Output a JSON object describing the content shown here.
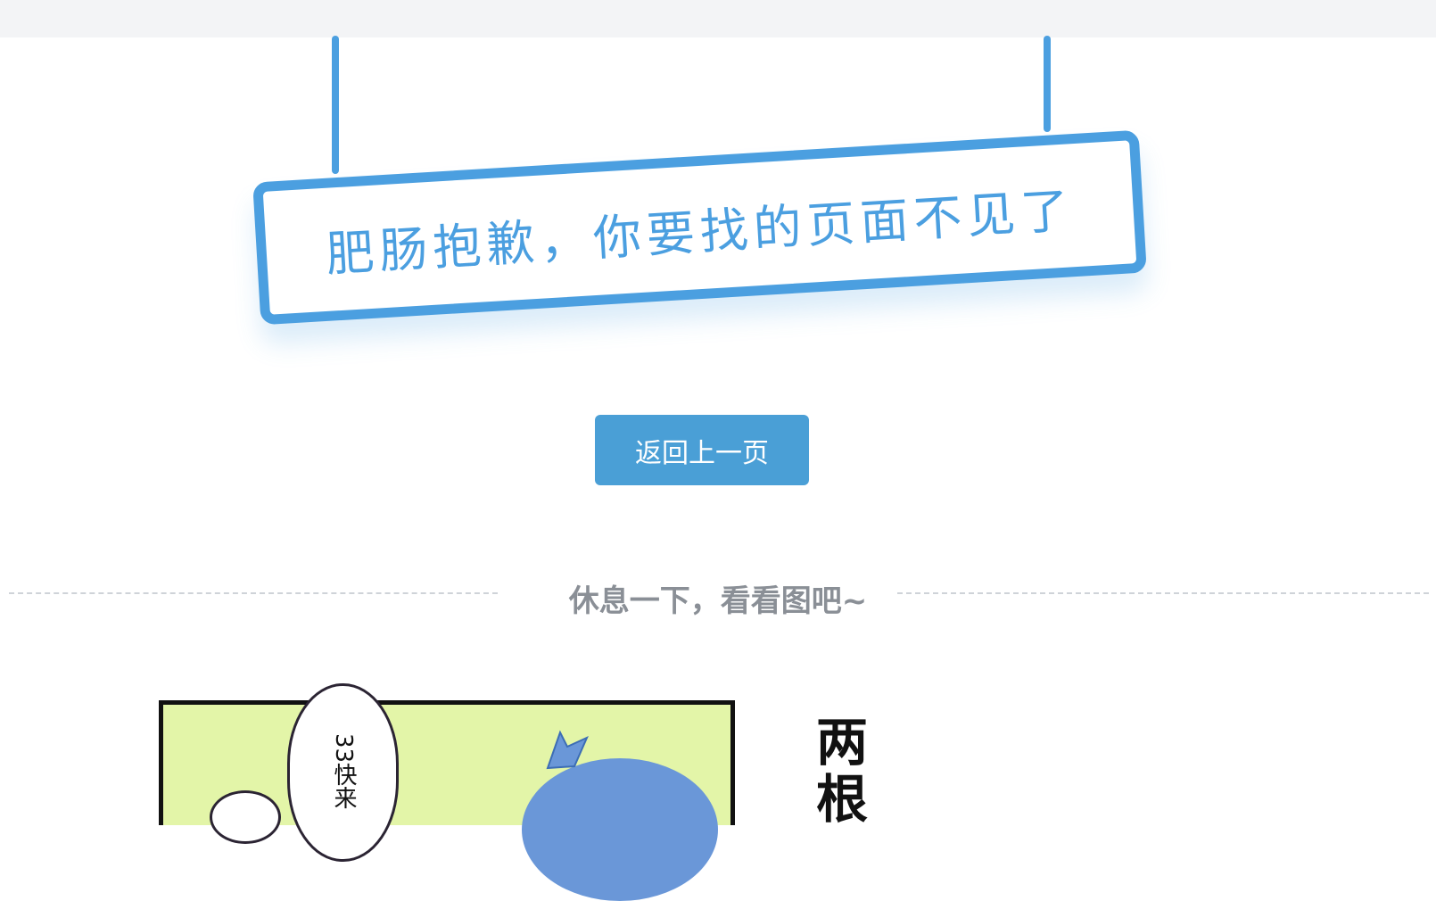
{
  "sign": {
    "text": "肥肠抱歉，你要找的页面不见了"
  },
  "actions": {
    "back_label": "返回上一页"
  },
  "divider": {
    "label": "休息一下，看看图吧~"
  },
  "comic": {
    "bubble_text": "33快来",
    "side_text": "两根"
  },
  "colors": {
    "accent": "#4b9fe0",
    "button": "#4a9fd6",
    "topbar": "#f3f4f6",
    "divider_text": "#8a8f96",
    "comic_bg": "#e3f5a8",
    "character": "#6a97d8"
  }
}
